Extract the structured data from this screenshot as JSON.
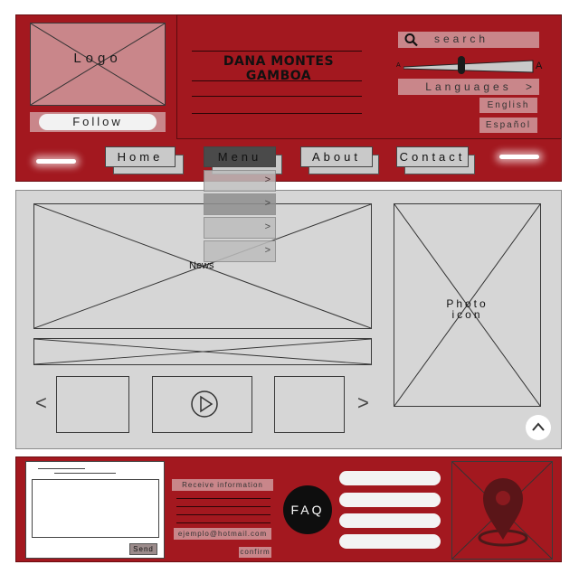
{
  "header": {
    "logo_label": "Logo",
    "follow_label": "Follow",
    "site_title": "DANA MONTES GAMBOA",
    "search_placeholder": "search",
    "font_size_small": "A",
    "font_size_large": "A",
    "languages_label": "Languages",
    "languages_chevron": ">",
    "language_options": [
      "English",
      "Español"
    ]
  },
  "nav": {
    "items": [
      "Home",
      "Menu",
      "About",
      "Contact"
    ],
    "active": "Menu",
    "dropdown_chevrons": [
      ">",
      ">",
      ">",
      ">"
    ]
  },
  "main": {
    "news_label": "News",
    "photo_label_line1": "Photo",
    "photo_label_line2": "icon",
    "prev_arrow": "<",
    "next_arrow": ">",
    "back_to_top_icon": "chevron-up-icon"
  },
  "footer": {
    "send_label": "Send",
    "receive_info_label": "Receive information",
    "email_label": "ejemplo@hotmail.com",
    "confirm_label": "confirm",
    "faq_label": "FAQ",
    "map_icon": "location-pin-icon"
  },
  "colors": {
    "brand_red": "#a3181f",
    "pink": "#c9868a",
    "panel_gray": "#d6d6d6",
    "nav_active": "#4a4a4a"
  }
}
